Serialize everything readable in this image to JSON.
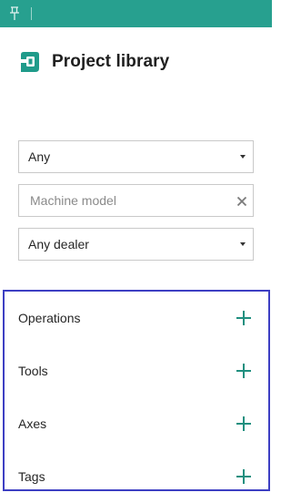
{
  "window": {
    "pin_icon": "pin-icon",
    "accent_color": "#27a08f"
  },
  "header": {
    "logo_icon": "library-logo-icon",
    "title": "Project library"
  },
  "controls": {
    "status_select": {
      "value": "Any",
      "icon": "dropdown-caret-icon"
    },
    "machine_model": {
      "placeholder": "Machine model",
      "value": "",
      "clear_icon": "clear-icon"
    },
    "dealer_select": {
      "value": "Any dealer",
      "icon": "dropdown-caret-icon"
    }
  },
  "filters": {
    "border_color": "#3d3fc3",
    "add_icon": "plus-icon",
    "items": [
      {
        "label": "Operations"
      },
      {
        "label": "Tools"
      },
      {
        "label": "Axes"
      },
      {
        "label": "Tags"
      }
    ]
  }
}
